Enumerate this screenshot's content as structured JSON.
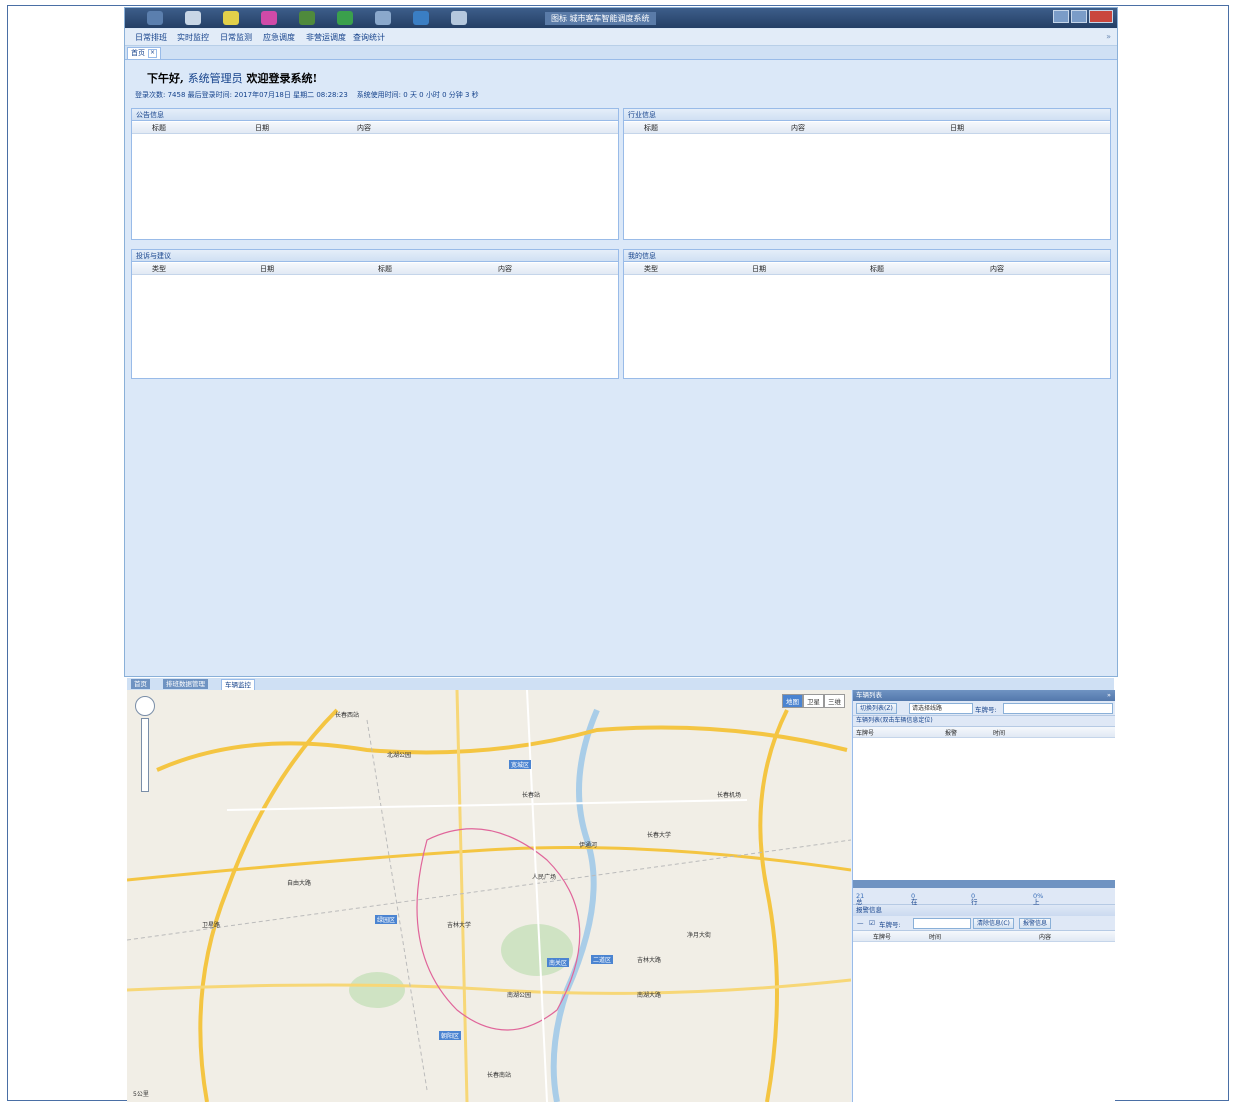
{
  "top_window": {
    "title": "图标 城市客车智能调度系统",
    "menu": [
      "日常排班",
      "实时监控",
      "日常监测",
      "应急调度",
      "非营运调度",
      "查询统计"
    ],
    "tab": "首页",
    "greeting_prefix": "下午好,",
    "user": "系统管理员",
    "greeting_suffix": "欢迎登录系统!",
    "login_count_label": "登录次数:",
    "login_count": "7458",
    "last_login_label": "最后登录时间:",
    "last_login": "2017年07月18日 星期二 08:28:23",
    "usage_label": "系统使用时间:",
    "usage": "0 天 0 小时 0 分钟 3 秒",
    "panels": {
      "notice": {
        "title": "公告信息",
        "cols": [
          "标题",
          "日期",
          "内容"
        ]
      },
      "industry": {
        "title": "行业信息",
        "cols": [
          "标题",
          "内容",
          "日期"
        ]
      },
      "complaint": {
        "title": "投诉与建议",
        "cols": [
          "类型",
          "日期",
          "标题",
          "内容"
        ]
      },
      "mine": {
        "title": "我的信息",
        "cols": [
          "类型",
          "日期",
          "标题",
          "内容"
        ]
      }
    }
  },
  "bottom_window": {
    "tabs": [
      "首页",
      "排班数据管理",
      "车辆监控"
    ],
    "map_types": [
      "地图",
      "卫星",
      "三维"
    ],
    "map_labels": [
      "长春西站",
      "朝阳区",
      "南关区",
      "二道区",
      "宽城区",
      "绿园区",
      "吉林大学",
      "长春站",
      "人民广场",
      "南湖公园",
      "伊通河",
      "净月大街",
      "长春大学",
      "北湖公园",
      "长春南站",
      "吉林大路",
      "自由大路",
      "卫星路",
      "南湖大路",
      "长春机场"
    ],
    "scale": "5公里",
    "vehicle_list": {
      "title": "车辆列表",
      "switch_btn": "切换列表(Z)",
      "line_placeholder": "请选择线路",
      "plate_label": "车牌号:",
      "sub_title": "车辆列表(双击车辆信息定位)",
      "cols": [
        "车牌号",
        "报警",
        "时间"
      ]
    },
    "stats": {
      "total_label": "总车辆:",
      "total": "21",
      "online_label": "在线车辆:",
      "online": "0",
      "running_label": "行驶车辆:",
      "running": "0",
      "rate_label": "上线率:",
      "rate": "0%"
    },
    "alarm": {
      "title": "报警信息",
      "plate_label": "车牌号:",
      "clear_btn": "清除信息(C)",
      "alarm_btn": "报警信息",
      "cols": [
        "车牌号",
        "时间",
        "内容"
      ]
    }
  }
}
